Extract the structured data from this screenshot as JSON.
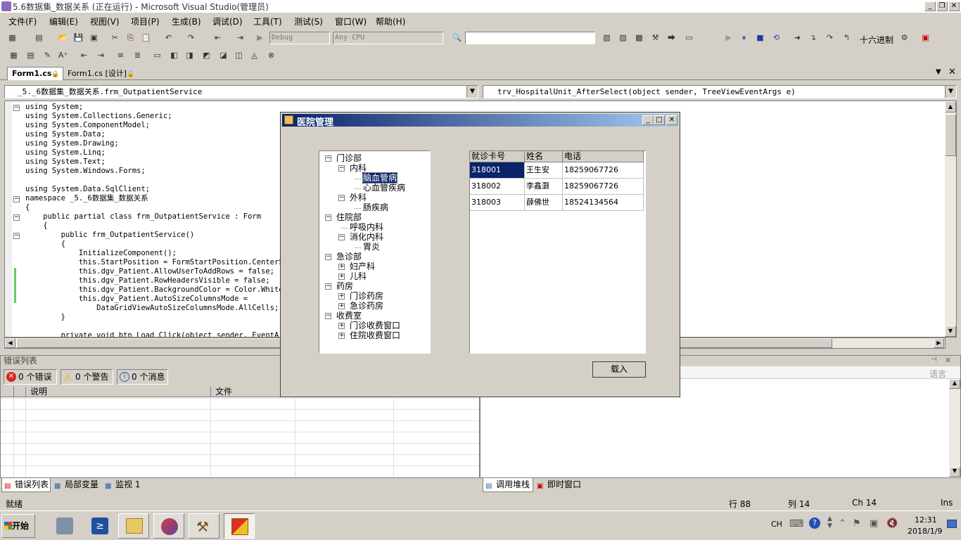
{
  "window": {
    "title": "5.6数据集_数据关系 (正在运行) - Microsoft Visual Studio(管理员)"
  },
  "menu": [
    "文件(F)",
    "编辑(E)",
    "视图(V)",
    "项目(P)",
    "生成(B)",
    "调试(D)",
    "工具(T)",
    "测试(S)",
    "窗口(W)",
    "帮助(H)"
  ],
  "toolbar": {
    "config": "Debug",
    "platform": "Any CPU",
    "hex_label": "十六进制"
  },
  "tabs": [
    {
      "label": "Form1.cs",
      "active": true
    },
    {
      "label": "Form1.cs [设计]",
      "active": false
    }
  ],
  "editor": {
    "class_combo": "_5._6数据集_数据关系.frm_OutpatientService",
    "member_combo": "trv_HospitalUnit_AfterSelect(object sender, TreeViewEventArgs e)",
    "lines": [
      "using System;",
      "using System.Collections.Generic;",
      "using System.ComponentModel;",
      "using System.Data;",
      "using System.Drawing;",
      "using System.Linq;",
      "using System.Text;",
      "using System.Windows.Forms;",
      "",
      "using System.Data.SqlClient;",
      "namespace _5._6数据集_数据关系",
      "{",
      "    public partial class frm_OutpatientService : Form",
      "    {",
      "        public frm_OutpatientService()",
      "        {",
      "            InitializeComponent();",
      "            this.StartPosition = FormStartPosition.CenterScre",
      "            this.dgv_Patient.AllowUserToAddRows = false;",
      "            this.dgv_Patient.RowHeadersVisible = false;",
      "            this.dgv_Patient.BackgroundColor = Color.White;",
      "            this.dgv_Patient.AutoSizeColumnsMode =",
      "                DataGridViewAutoSizeColumnsMode.AllCells;",
      "        }",
      "",
      "        private void btn_Load_Click(object sender, EventArgs e"
    ]
  },
  "dialog": {
    "title": "医院管理",
    "tree": [
      {
        "label": "门诊部",
        "level": 0,
        "expander": "minus"
      },
      {
        "label": "内科",
        "level": 1,
        "expander": "minus"
      },
      {
        "label": "脑血管病",
        "level": 2,
        "expander": "none",
        "selected": true
      },
      {
        "label": "心血管疾病",
        "level": 2,
        "expander": "none"
      },
      {
        "label": "外科",
        "level": 1,
        "expander": "minus"
      },
      {
        "label": "肠疾病",
        "level": 2,
        "expander": "none"
      },
      {
        "label": "住院部",
        "level": 0,
        "expander": "minus"
      },
      {
        "label": "呼吸内科",
        "level": 1,
        "expander": "none"
      },
      {
        "label": "消化内科",
        "level": 1,
        "expander": "minus"
      },
      {
        "label": "胃炎",
        "level": 2,
        "expander": "none"
      },
      {
        "label": "急诊部",
        "level": 0,
        "expander": "minus"
      },
      {
        "label": "妇产科",
        "level": 1,
        "expander": "plus"
      },
      {
        "label": "儿科",
        "level": 1,
        "expander": "plus"
      },
      {
        "label": "药房",
        "level": 0,
        "expander": "minus"
      },
      {
        "label": "门诊药房",
        "level": 1,
        "expander": "plus"
      },
      {
        "label": "急诊药房",
        "level": 1,
        "expander": "plus"
      },
      {
        "label": "收费室",
        "level": 0,
        "expander": "minus"
      },
      {
        "label": "门诊收费窗口",
        "level": 1,
        "expander": "plus"
      },
      {
        "label": "住院收费窗口",
        "level": 1,
        "expander": "plus"
      }
    ],
    "grid": {
      "columns": [
        "就诊卡号",
        "姓名",
        "电话"
      ],
      "rows": [
        [
          "318001",
          "王生安",
          "18259067726"
        ],
        [
          "318002",
          "李鑫灏",
          "18259067726"
        ],
        [
          "318003",
          "薛佛世",
          "18524134564"
        ]
      ]
    },
    "load_button": "载入"
  },
  "error_list": {
    "title": "错误列表",
    "errors": "0 个错误",
    "warnings": "0 个警告",
    "messages": "0 个消息",
    "col_desc": "说明",
    "col_file": "文件"
  },
  "right_panel": {
    "lang_label": "语言"
  },
  "bottom_tabs_left": [
    "错误列表",
    "局部变量",
    "监视 1"
  ],
  "bottom_tabs_right": [
    "调用堆栈",
    "即时窗口"
  ],
  "statusbar": {
    "text": "就绪",
    "line": "行 88",
    "col": "列 14",
    "ch": "Ch 14",
    "ins": "Ins"
  },
  "taskbar": {
    "start": "开始",
    "lang": "CH",
    "time": "12:31",
    "date": "2018/1/9"
  }
}
